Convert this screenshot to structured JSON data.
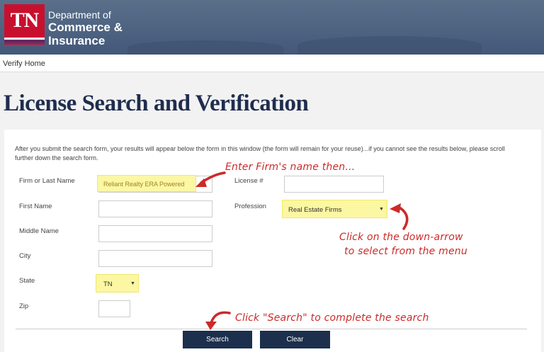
{
  "header": {
    "logo_text": "TN",
    "dept_line1": "Department of",
    "dept_line2": "Commerce &",
    "dept_line3": "Insurance"
  },
  "breadcrumb": "Verify Home",
  "page_title": "License Search and Verification",
  "intro_text": "After you submit the search form, your results will appear below the form in this window (the form will remain for your reuse)...if you cannot see the results below, please scroll further down the search form.",
  "form": {
    "firm_label": "Firm or Last Name",
    "firm_value": "Reliant Realty ERA Powered",
    "first_label": "First Name",
    "middle_label": "Middle Name",
    "city_label": "City",
    "state_label": "State",
    "state_value": "TN",
    "zip_label": "Zip",
    "license_label": "License #",
    "profession_label": "Profession",
    "profession_value": "Real Estate Firms"
  },
  "buttons": {
    "search": "Search",
    "clear": "Clear"
  },
  "annotations": {
    "note1": "Enter Firm's name then...",
    "note2_line1": "Click on the down-arrow",
    "note2_line2": "to select from the menu",
    "note3": "Click \"Search\" to complete the search"
  },
  "colors": {
    "header_bg": "#4c6280",
    "logo_red": "#c8102e",
    "title_navy": "#1f2d4f",
    "button_navy": "#1c2f4c",
    "highlight_yellow": "#fbf7a2",
    "annotation_red": "#cc2a2a"
  },
  "icons": {
    "dropdown": "chevron-down-icon",
    "annotation_arrow": "curved-arrow-icon"
  }
}
